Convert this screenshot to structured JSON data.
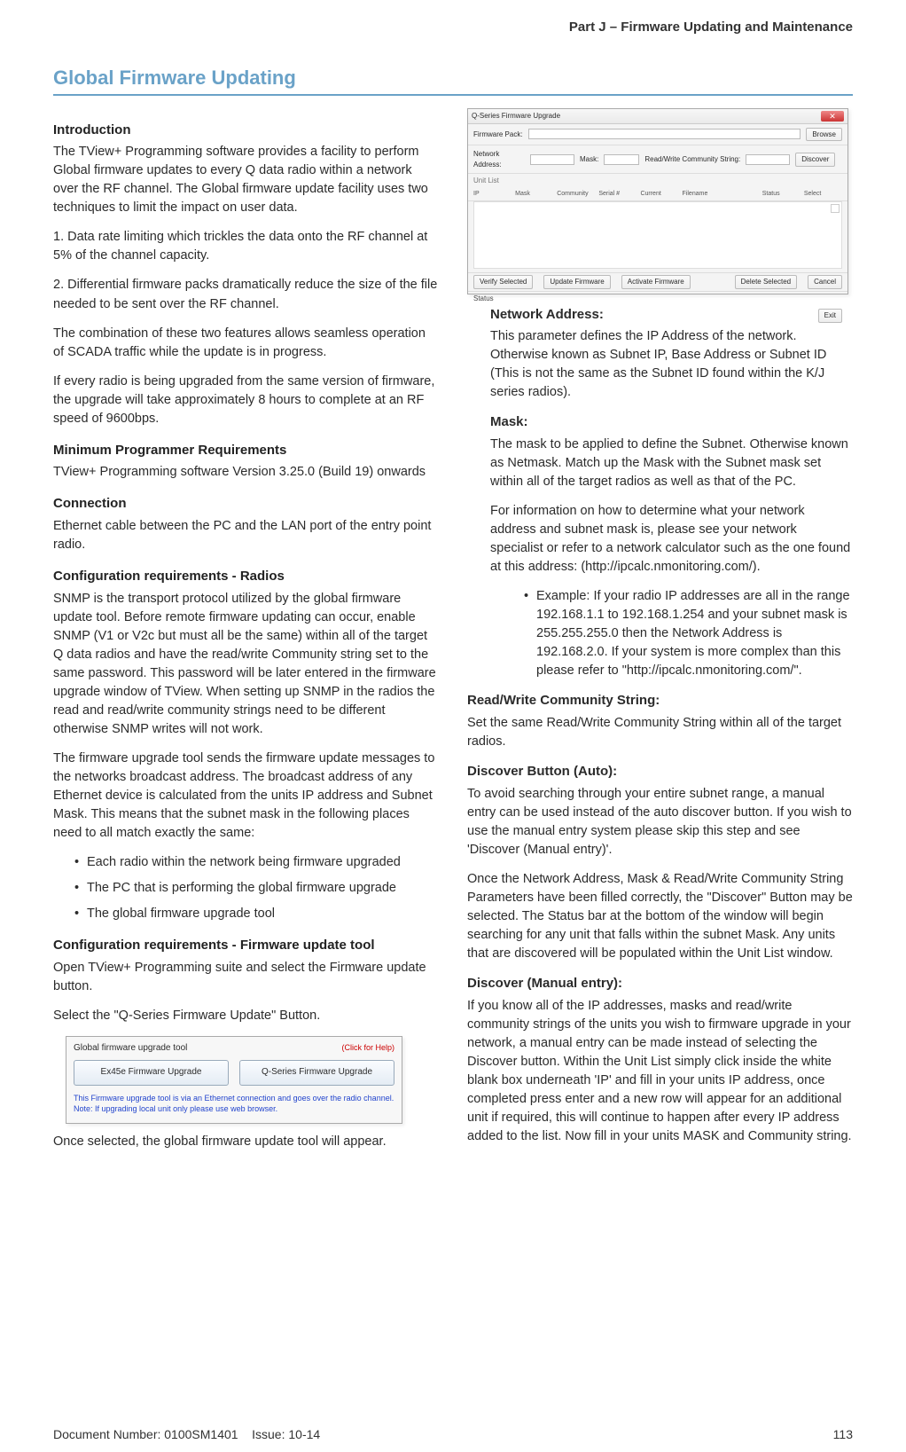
{
  "header": {
    "part_title": "Part J – Firmware Updating and Maintenance"
  },
  "section": {
    "title": "Global Firmware Updating"
  },
  "left": {
    "h_intro": "Introduction",
    "p_intro_1": "The TView+ Programming software provides a facility to perform Global firmware updates to every Q data radio within a network over the RF channel. The Global firmware update facility uses two techniques to limit the impact on user data.",
    "p_intro_2": "1. Data rate limiting which trickles the data onto the RF channel at 5% of the channel capacity.",
    "p_intro_3": "2. Differential firmware packs dramatically reduce the size of the file needed to be sent over the RF channel.",
    "p_intro_4": "The combination of these two features allows seamless operation of SCADA traffic while the update is in progress.",
    "p_intro_5": "If every radio is being upgraded from the same version of firmware, the upgrade will take approximately 8 hours to complete at an RF speed of 9600bps.",
    "h_minreq": "Minimum Programmer Requirements",
    "p_minreq": "TView+ Programming software Version 3.25.0 (Build 19) onwards",
    "h_conn": "Connection",
    "p_conn": "Ethernet cable between the PC and the LAN port of the entry point radio.",
    "h_cfg_radios": "Configuration requirements - Radios",
    "p_cfg_radios_1": "SNMP is the transport protocol utilized by the global firmware update tool. Before remote firmware updating can occur, enable SNMP (V1 or V2c but must all be the same) within all of the target Q data radios and have the read/write Community string set to the same password. This password will be later entered in the firmware upgrade window of TView. When setting up SNMP in the radios the read and read/write community strings need to be different otherwise SNMP writes will not work.",
    "p_cfg_radios_2": "The firmware upgrade tool sends the firmware update messages to the networks broadcast address. The broadcast address of any Ethernet device is calculated from the units IP address and Subnet Mask. This means that the subnet mask in the following places need to all match exactly the same:",
    "b1": "Each radio within the network being firmware upgraded",
    "b2": "The PC that is performing the global firmware upgrade",
    "b3": "The global firmware upgrade tool",
    "h_cfg_tool": "Configuration requirements - Firmware update tool",
    "p_cfg_tool_1": "Open TView+ Programming suite and select the Firmware update button.",
    "p_cfg_tool_2": "Select the \"Q-Series Firmware Update\" Button.",
    "p_once": "Once selected, the global firmware update tool will appear."
  },
  "dialog1": {
    "title": "Global firmware upgrade tool",
    "click_help": "(Click for Help)",
    "btn1": "Ex45e Firmware Upgrade",
    "btn2": "Q-Series Firmware Upgrade",
    "note1": "This Firmware upgrade tool is via an Ethernet connection and goes over the radio channel.",
    "note2": "Note: If upgrading local unit only please use web browser."
  },
  "dialog2": {
    "title": "Q-Series Firmware Upgrade",
    "firmware_pack": "Firmware Pack:",
    "browse": "Browse",
    "network_addr": "Network Address:",
    "mask": "Mask:",
    "rw_string": "Read/Write Community String:",
    "discover": "Discover",
    "unit_list": "Unit List",
    "cols": [
      "IP",
      "Mask",
      "Community",
      "Serial #",
      "Current",
      "Filename",
      "Status",
      "Select"
    ],
    "act_verify": "Verify Selected",
    "act_update": "Update Firmware",
    "act_activate": "Activate Firmware",
    "act_delete": "Delete Selected",
    "act_cancel": "Cancel",
    "status": "Status",
    "exit": "Exit"
  },
  "right": {
    "h_net": "Network Address:",
    "p_net": "This parameter defines the IP Address of the network. Otherwise known as Subnet IP, Base Address or Subnet ID (This is not the same as the Subnet ID found within the K/J series radios).",
    "h_mask": "Mask:",
    "p_mask_1": "The mask to be applied to define the Subnet. Otherwise known as Netmask. Match up the Mask with the Subnet mask set within all of the target radios as well as that of the PC.",
    "p_mask_2": "For information on how to determine what your network address and subnet mask is, please see your network specialist or refer to a network calculator such as the one found at this address: (http://ipcalc.nmonitoring.com/).",
    "b_example": "Example: If your radio IP addresses are all in the range 192.168.1.1 to 192.168.1.254 and your subnet mask is 255.255.255.0 then the Network Address is 192.168.2.0. If your system is more complex than this please refer to \"http://ipcalc.nmonitoring.com/\".",
    "h_rw": "Read/Write Community String:",
    "p_rw": "Set the same Read/Write Community String within all of the target radios.",
    "h_discover_auto": "Discover Button (Auto):",
    "p_discover_auto_1": "To avoid searching through your entire subnet range, a manual entry can be used instead of the auto discover button. If you wish to use the manual entry system please skip this step and see 'Discover (Manual entry)'.",
    "p_discover_auto_2": "Once the Network Address, Mask & Read/Write Community String Parameters have been filled correctly, the \"Discover\" Button may be selected. The Status bar at the bottom of the window will begin searching for any unit that falls within the subnet Mask. Any units that are discovered will be populated within the Unit List window.",
    "h_discover_manual": "Discover (Manual entry):",
    "p_discover_manual": "If you know all of the IP addresses, masks and read/write community strings of the units you wish to firmware upgrade in your network, a manual entry can be made instead of selecting the Discover button. Within the Unit List simply click inside the white blank box underneath 'IP' and fill in your units IP address, once completed press enter and a new row will appear for an additional unit if required, this will continue to happen after every IP address added to the list. Now fill in your units MASK and Community string."
  },
  "footer": {
    "doc_num": "Document Number: 0100SM1401",
    "issue": "Issue: 10-14",
    "page": "113"
  }
}
